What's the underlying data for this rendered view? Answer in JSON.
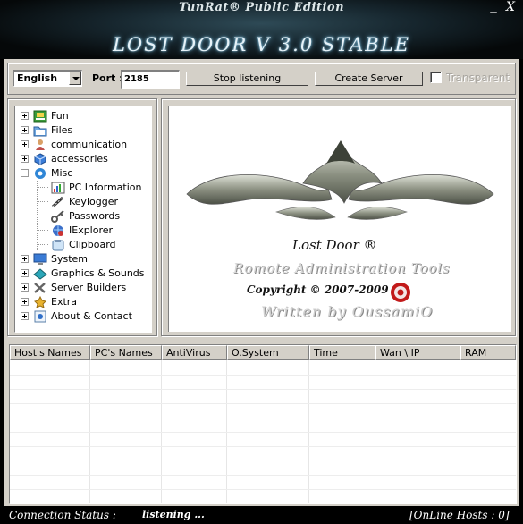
{
  "window": {
    "edition": "TunRat® Public Edition",
    "title": "LOST DOOR V 3.0  STABLE",
    "min_glyph": "_",
    "close_glyph": "X"
  },
  "toolbar": {
    "language": "English",
    "port_label": "Port :",
    "port_value": "2185",
    "stop_label": "Stop listening",
    "create_label": "Create Server",
    "transparent_label": "Transparent",
    "transparent_checked": false
  },
  "tree": {
    "items": [
      {
        "label": "Fun",
        "icon": "fun-icon",
        "expander": "plus"
      },
      {
        "label": "Files",
        "icon": "folder-icon",
        "expander": "plus"
      },
      {
        "label": "communication",
        "icon": "user-icon",
        "expander": "plus"
      },
      {
        "label": "accessories",
        "icon": "cube-icon",
        "expander": "plus"
      },
      {
        "label": "Misc",
        "icon": "gear-icon",
        "expander": "minus"
      },
      {
        "label": "PC Information",
        "icon": "chart-icon",
        "child": true
      },
      {
        "label": "Keylogger",
        "icon": "keyboard-icon",
        "child": true
      },
      {
        "label": "Passwords",
        "icon": "key-icon",
        "child": true
      },
      {
        "label": "IExplorer",
        "icon": "globe-icon",
        "child": true
      },
      {
        "label": "Clipboard",
        "icon": "clipboard-icon",
        "child": true
      },
      {
        "label": "System",
        "icon": "monitor-icon",
        "expander": "plus"
      },
      {
        "label": "Graphics & Sounds",
        "icon": "graphics-icon",
        "expander": "plus"
      },
      {
        "label": "Server Builders",
        "icon": "tools-icon",
        "expander": "plus"
      },
      {
        "label": "Extra",
        "icon": "star-icon",
        "expander": "plus"
      },
      {
        "label": "About & Contact",
        "icon": "help-icon",
        "expander": "plus"
      }
    ]
  },
  "logo": {
    "name": "Lost Door ®",
    "subtitle": "Romote Administration Tools",
    "copyright": "Copyright © 2007-2009",
    "author": "Written by OussamiO"
  },
  "hosts": {
    "columns": [
      "Host's Names",
      "PC's Names",
      "AntiVirus",
      "O.System",
      "Time",
      "Wan \\ IP",
      "RAM"
    ],
    "rows": []
  },
  "status": {
    "label": "Connection Status :",
    "value": "listening ...",
    "hosts": "[OnLine Hosts : 0]"
  },
  "colors": {
    "face": "#d4d0c8",
    "accent": "#1a3a8a",
    "title_glow": "#6fb6d8"
  }
}
